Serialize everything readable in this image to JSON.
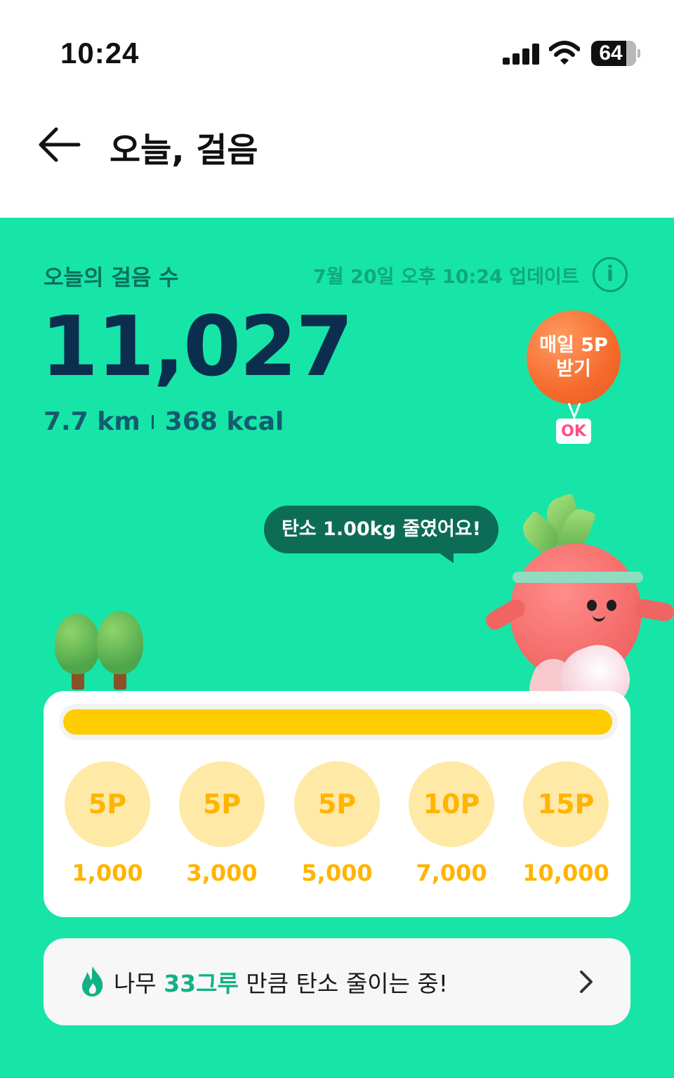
{
  "status_bar": {
    "time": "10:24",
    "battery_level": "64",
    "icons": [
      "signal-icon",
      "wifi-icon",
      "battery-icon"
    ]
  },
  "header": {
    "title": "오늘, 걸음",
    "back_icon": "back-arrow-icon"
  },
  "today": {
    "label": "오늘의 걸음 수",
    "updated": "7월 20일 오후 10:24 업데이트",
    "info_icon": "info-icon",
    "step_count": "11,027",
    "distance": "7.7 km",
    "calories": "368 kcal"
  },
  "daily_reward": {
    "label_line1": "매일 5P",
    "label_line2": "받기",
    "badge": "OK"
  },
  "speech_bubble": {
    "text": "탄소 1.00kg 줄였어요!"
  },
  "progress": {
    "fraction": 1.0,
    "milestones": [
      {
        "points": "5P",
        "steps": "1,000"
      },
      {
        "points": "5P",
        "steps": "3,000"
      },
      {
        "points": "5P",
        "steps": "5,000"
      },
      {
        "points": "10P",
        "steps": "7,000"
      },
      {
        "points": "15P",
        "steps": "10,000"
      }
    ]
  },
  "carbon": {
    "prefix": "나무 ",
    "highlight": "33그루",
    "suffix": " 만큼 탄소 줄이는 중!",
    "icon": "flame-icon",
    "chevron": "chevron-right-icon"
  },
  "colors": {
    "main_bg": "#16e5a7",
    "progress": "#ffcc00",
    "coin": "#ffe9a6",
    "accent_text": "#10b185"
  }
}
